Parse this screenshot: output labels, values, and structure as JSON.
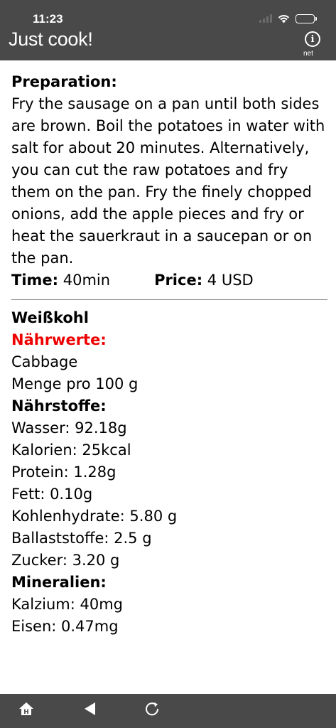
{
  "status_bar": {
    "time": "11:23"
  },
  "app": {
    "title": "Just cook!",
    "info_label": "net"
  },
  "preparation": {
    "heading": "Preparation:",
    "text": "Fry the sausage on a pan until both sides are brown. Boil the potatoes in water with salt for about 20 minutes. Alternatively, you can cut the raw potatoes and fry them on the pan. Fry the finely chopped onions, add the apple pieces and fry or heat the sauerkraut in a saucepan or on the pan."
  },
  "meta": {
    "time_label": "Time:",
    "time_value": "40min",
    "price_label": "Price:",
    "price_value": "4 USD"
  },
  "nutrition": {
    "ingredient": "Weißkohl",
    "nutrients_heading": "Nährwerte:",
    "translation": "Cabbage",
    "amount": "Menge pro 100 g",
    "substances_heading": "Nährstoffe:",
    "substances": [
      "Wasser: 92.18g",
      "Kalorien: 25kcal",
      "Protein: 1.28g",
      "Fett: 0.10g",
      "Kohlenhydrate: 5.80 g",
      "Ballaststoffe: 2.5 g",
      "Zucker: 3.20 g"
    ],
    "minerals_heading": "Mineralien:",
    "minerals": [
      "Kalzium: 40mg",
      "Eisen: 0.47mg"
    ]
  },
  "bottom_bar": {
    "home_icon": "home-icon",
    "back_icon": "back-arrow-icon",
    "reload_icon": "reload-icon"
  },
  "colors": {
    "bar": "#494949",
    "accent": "#ee0000"
  }
}
